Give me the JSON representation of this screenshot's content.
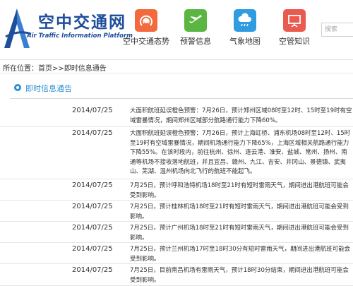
{
  "site": {
    "name_cn": "空中交通网",
    "name_en": "Air Traffic Information Platform"
  },
  "nav": [
    {
      "label": "空中交通态势",
      "icon": "radio-signal-icon",
      "color": "#f26a3d"
    },
    {
      "label": "预警信息",
      "icon": "plane-icon",
      "color": "#5bb543"
    },
    {
      "label": "气象地图",
      "icon": "cloud-rain-icon",
      "color": "#2f9be0"
    },
    {
      "label": "空管知识",
      "icon": "presentation-icon",
      "color": "#e95b4e"
    }
  ],
  "search": {
    "placeholder": "搜索"
  },
  "breadcrumb": {
    "text": "所在位置：首页>>即时信息通告"
  },
  "section": {
    "title": "即时信息通告"
  },
  "notices": [
    {
      "date": "2014/07/25",
      "text": "大面积航班延误橙色预警：7月26日，预计郑州区域08时至12时、15时至19时有空域雷暴情况，期间郑州区域部分航路通行能力下降60%。"
    },
    {
      "date": "2014/07/25",
      "text": "大面积航班延误橙色预警：7月26日，预计上海虹桥、浦东机场08时至12时、15时至19时有空域雷暴情况，期间机场通行能力下降65%，上海区域相关航路通行能力下降55%。在该时段内，前往杭州、徐州、连云港、淮安、盐城、常州、扬州、南通等机场不接收落地航班，并且宜昌、赣州、九江、吉安、井冈山、景德镇、武夷山、芜湖、温州机场向北飞行的航班不能起飞。"
    },
    {
      "date": "2014/07/25",
      "text": "7月25日，预计呼和浩特机场18时至21时有短时雷雨天气，期间进出港航班可能会受到影响。"
    },
    {
      "date": "2014/07/25",
      "text": "7月25日，预计桂林机场18时至21时有短时雷雨天气，期间进出港航班可能会受到影响。"
    },
    {
      "date": "2014/07/25",
      "text": "7月25日，预计广州机场18时至21时有短时雷雨天气，期间进出港航班可能会受到影响。"
    },
    {
      "date": "2014/07/25",
      "text": "7月25日，预计兰州机场17时至18时30分有短时雷雨天气，期间进出港航班可能会受到影响。"
    },
    {
      "date": "2014/07/25",
      "text": "7月25日，目前南昌机场有雷雨天气，预计18时30分结束，期间进出港航班可能会受到影响。"
    }
  ]
}
